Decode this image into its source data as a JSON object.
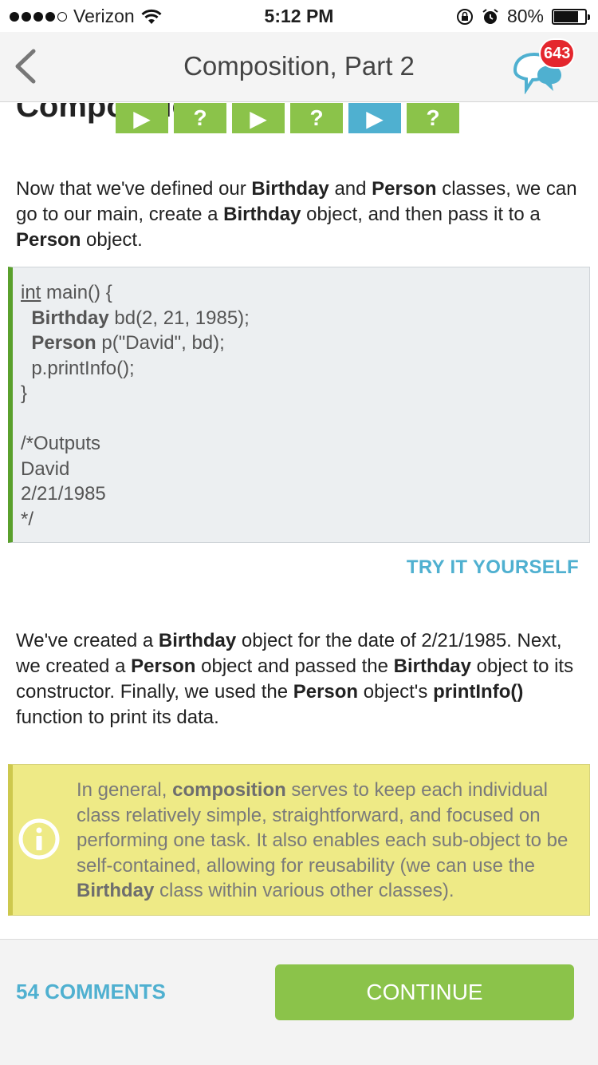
{
  "status_bar": {
    "carrier": "Verizon",
    "time": "5:12 PM",
    "battery": "80%",
    "battery_level": 0.8,
    "signal_bars": 4,
    "icons": [
      "wifi-icon",
      "rotation-lock-icon",
      "alarm-icon",
      "battery-icon"
    ]
  },
  "header": {
    "title": "Composition, Part 2",
    "back_icon": "chevron-left-icon",
    "chat_icon": "chat-bubbles-icon",
    "notification_count": "643"
  },
  "progress": {
    "steps": [
      {
        "glyph": "▶",
        "type": "text"
      },
      {
        "glyph": "?",
        "type": "quiz"
      },
      {
        "glyph": "▶",
        "type": "text"
      },
      {
        "glyph": "?",
        "type": "quiz"
      },
      {
        "glyph": "▶",
        "type": "text",
        "current": true
      },
      {
        "glyph": "?",
        "type": "quiz"
      }
    ]
  },
  "lesson": {
    "heading": "Composition",
    "intro": [
      {
        "t": "Now that we've defined our "
      },
      {
        "t": "Birthday",
        "b": true
      },
      {
        "t": " and "
      },
      {
        "t": "Person",
        "b": true
      },
      {
        "t": " classes, we can go to our main, create a "
      },
      {
        "t": "Birthday",
        "b": true
      },
      {
        "t": " object, and then pass it to a "
      },
      {
        "t": "Person",
        "b": true
      },
      {
        "t": " object."
      }
    ],
    "code": [
      [
        {
          "t": "int",
          "u": true
        },
        {
          "t": " main() {"
        }
      ],
      [
        {
          "t": "  "
        },
        {
          "t": "Birthday",
          "b": true
        },
        {
          "t": " bd(2, 21, 1985);"
        }
      ],
      [
        {
          "t": "  "
        },
        {
          "t": "Person",
          "b": true
        },
        {
          "t": " p(\"David\", bd);"
        }
      ],
      [
        {
          "t": "  p.printInfo();"
        }
      ],
      [
        {
          "t": "}"
        }
      ],
      [
        {
          "t": ""
        }
      ],
      [
        {
          "t": "/*Outputs"
        }
      ],
      [
        {
          "t": "David"
        }
      ],
      [
        {
          "t": "2/21/1985"
        }
      ],
      [
        {
          "t": "*/"
        }
      ]
    ],
    "try_it_label": "TRY IT YOURSELF",
    "explanation": [
      {
        "t": "We've created a "
      },
      {
        "t": "Birthday",
        "b": true
      },
      {
        "t": " object for the date of 2/21/1985. Next, we created a "
      },
      {
        "t": "Person",
        "b": true
      },
      {
        "t": " object and passed the "
      },
      {
        "t": "Birthday",
        "b": true
      },
      {
        "t": " object to its constructor. Finally, we used the "
      },
      {
        "t": "Person",
        "b": true
      },
      {
        "t": " object's "
      },
      {
        "t": "printInfo()",
        "b": true
      },
      {
        "t": " function to print its data."
      }
    ],
    "note_icon": "info-icon",
    "note": [
      {
        "t": "In general, "
      },
      {
        "t": "composition",
        "b": true
      },
      {
        "t": " serves to keep each individual class relatively simple, straightforward, and focused on performing one task. It also enables each sub-object to be self-contained, allowing for reusability (we can use the "
      },
      {
        "t": "Birthday",
        "b": true
      },
      {
        "t": " class within various other classes)."
      }
    ]
  },
  "footer": {
    "comments_label": "54 COMMENTS",
    "continue_label": "CONTINUE"
  },
  "colors": {
    "green": "#8bc34a",
    "blue": "#4fb0d0",
    "code_border": "#5aa02c",
    "note_bg": "#eeea86",
    "badge_red": "#e4262d"
  }
}
